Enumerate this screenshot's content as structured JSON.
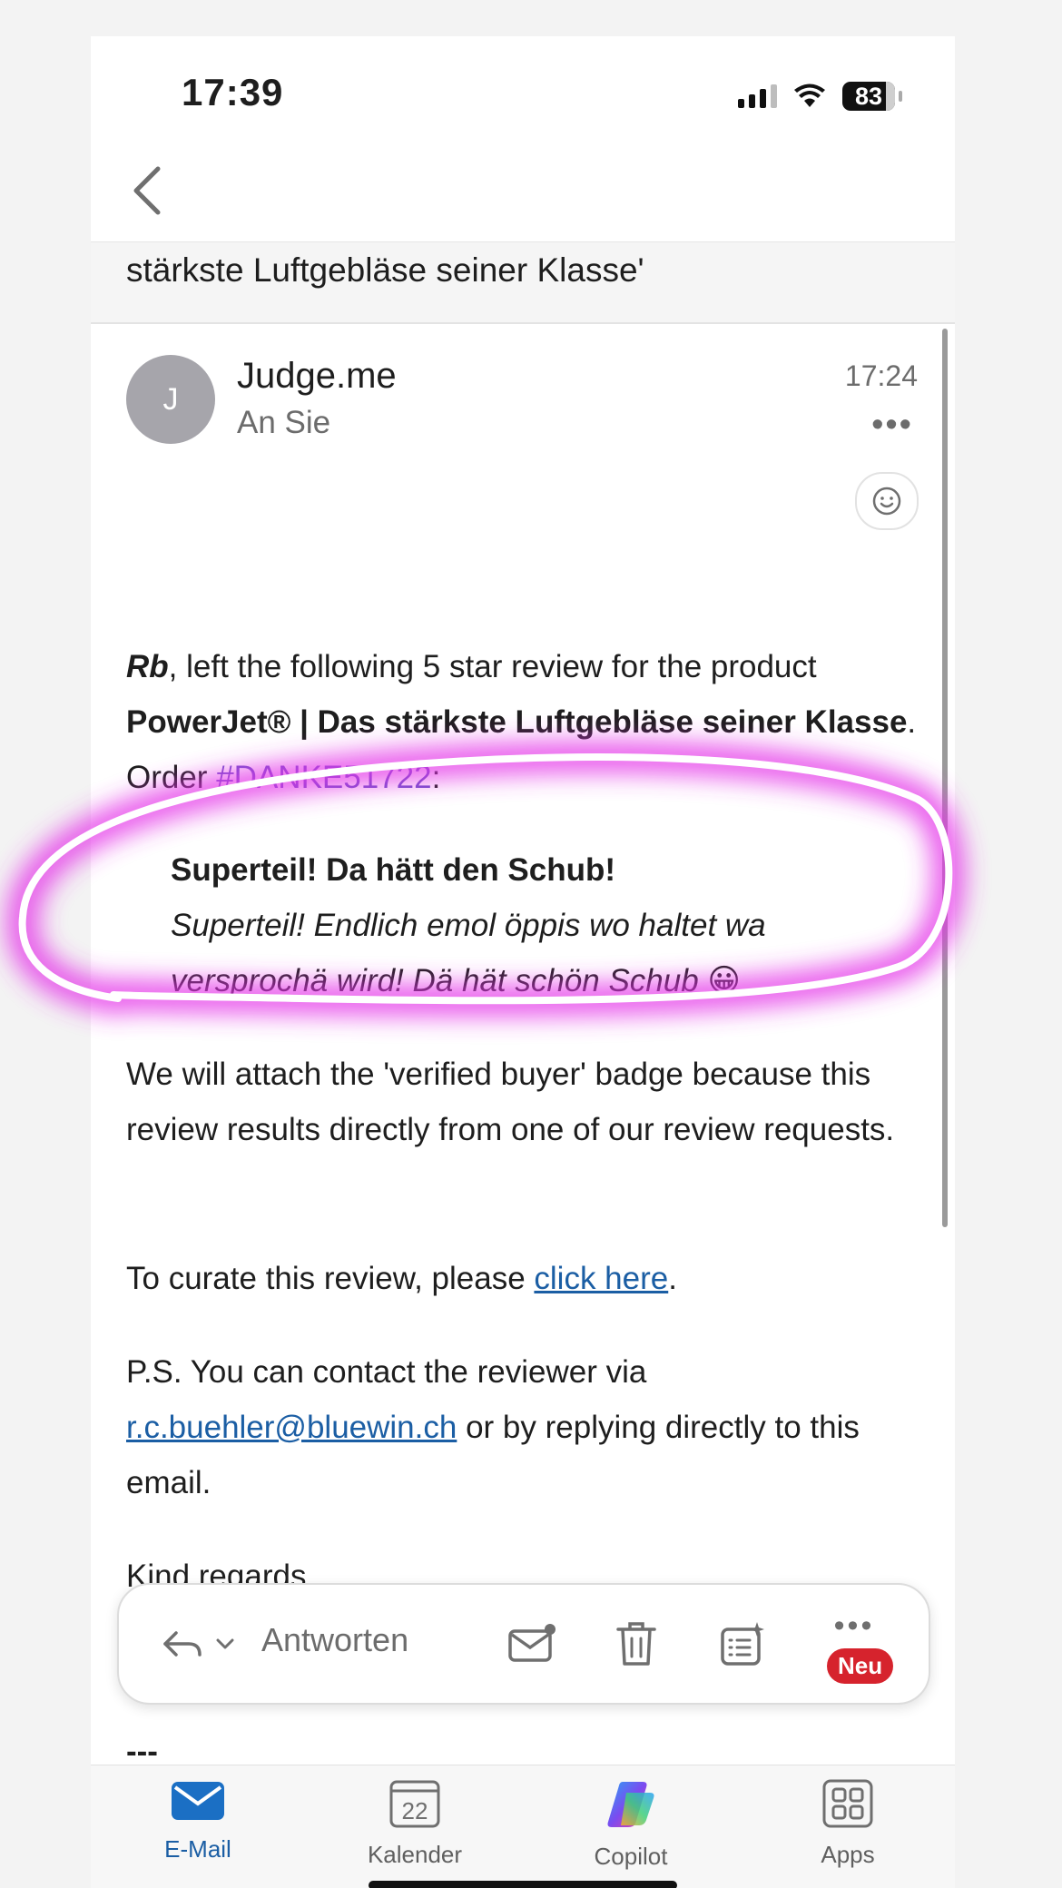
{
  "status": {
    "time": "17:39",
    "battery": "83"
  },
  "subject": "stärkste Luftgebläse seiner Klasse'",
  "sender": {
    "avatar_letter": "J",
    "name": "Judge.me",
    "to": "An Sie",
    "time": "17:24",
    "more": "•••"
  },
  "body": {
    "p1_reviewer": "Rb",
    "p1_text1": ", left the following 5 star review for the product ",
    "p1_product": "PowerJet® | Das stärkste Luftgebläse seiner Klasse",
    "p1_text2": ". Order ",
    "p1_order": "#DANKE51722",
    "p1_text3": ":",
    "review_title": "Superteil! Da hätt den Schub!",
    "review_text": "Superteil! Endlich emol öppis wo haltet wa versprochä wird! Dä hät schön Schub 😀",
    "p2": "We will attach the 'verified buyer' badge because this review results directly from one of our review requests.",
    "p3_text1": "To curate this review, please ",
    "p3_link": "click here",
    "p3_text2": ".",
    "p4_text1": "P.S. You can contact the reviewer via ",
    "p4_email": "r.c.buehler@bluewin.ch",
    "p4_text2": " or by replying directly to this email.",
    "p5": "Kind regards,",
    "dashes": "---"
  },
  "toolbar": {
    "reply_label": "Antworten",
    "badge": "Neu",
    "more": "•••"
  },
  "tabs": [
    {
      "label": "E-Mail",
      "icon": "mail-icon",
      "active": true
    },
    {
      "label": "Kalender",
      "icon": "calendar-icon",
      "calendar_day": "22"
    },
    {
      "label": "Copilot",
      "icon": "copilot-icon"
    },
    {
      "label": "Apps",
      "icon": "apps-icon"
    }
  ],
  "colors": {
    "accent": "#1b5ea4",
    "highlight": "#e436e8",
    "badge": "#d6232d"
  }
}
